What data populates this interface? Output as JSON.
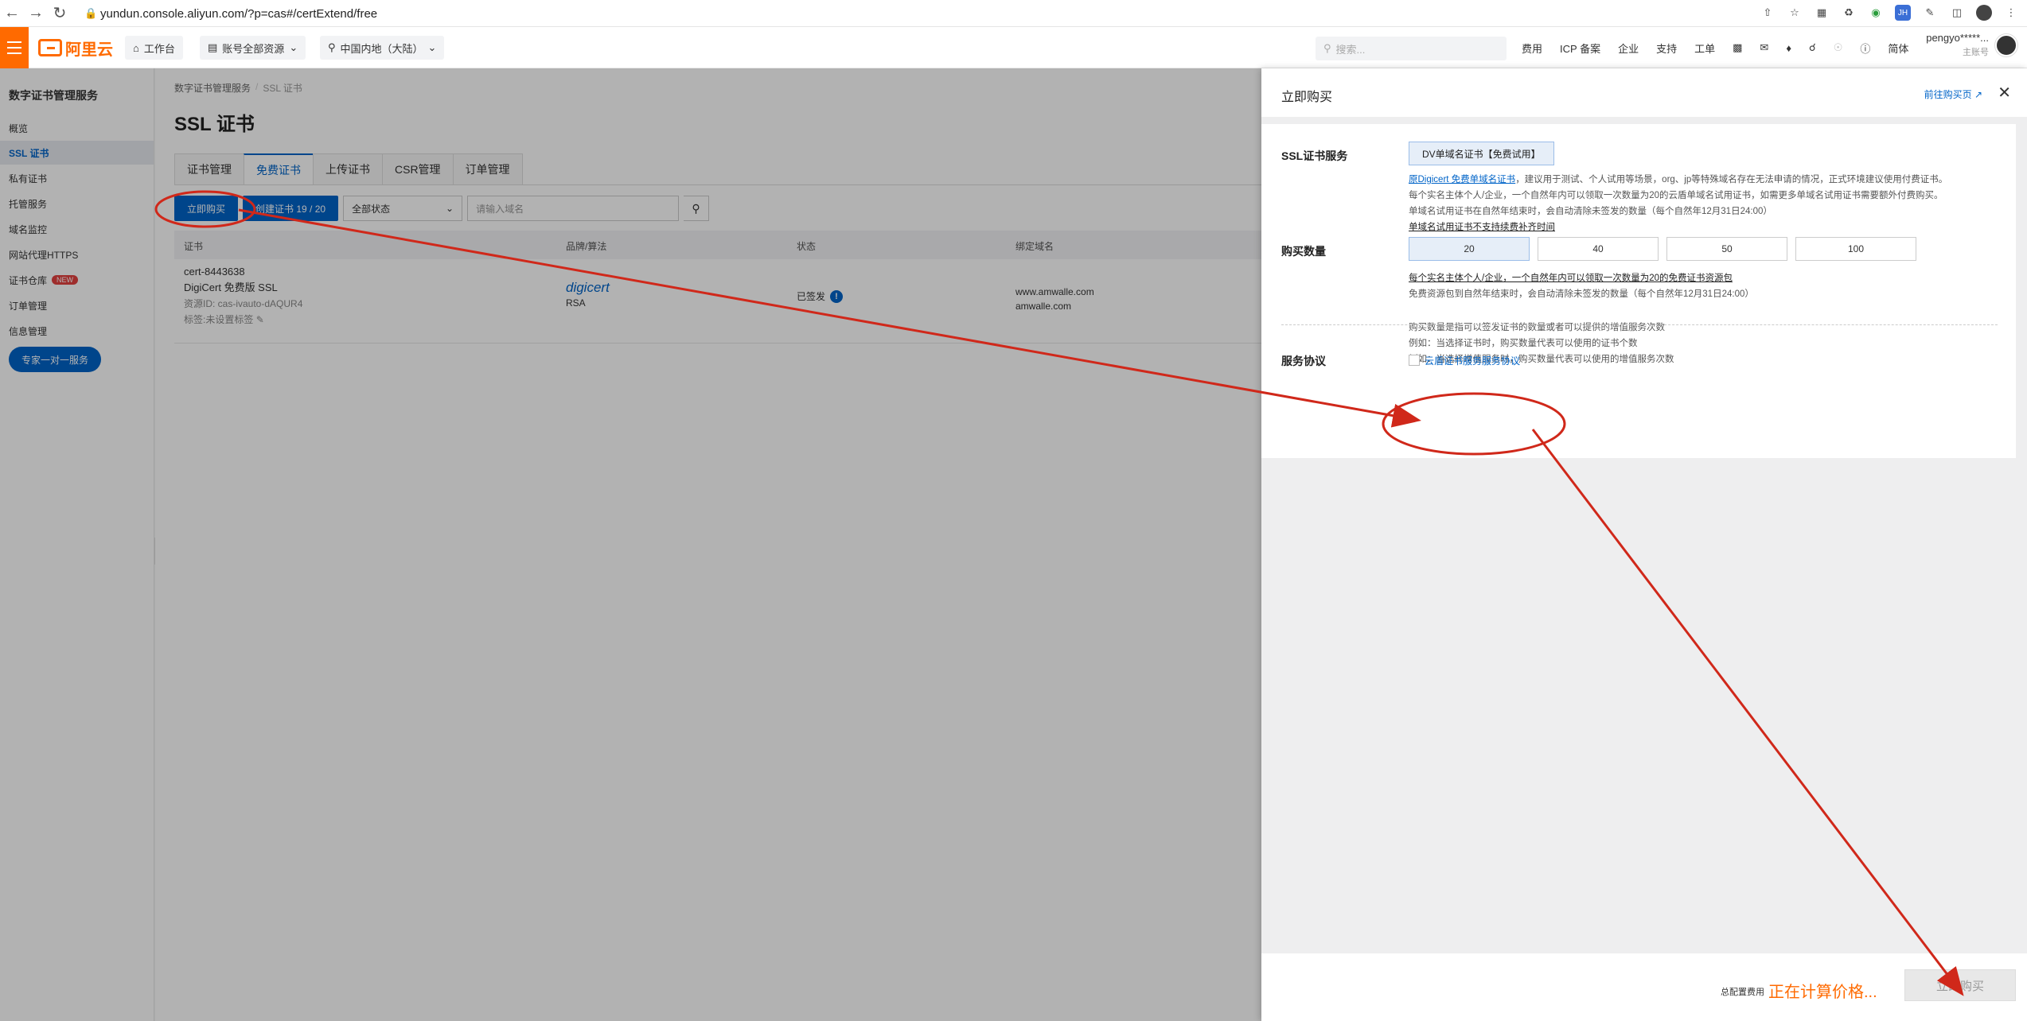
{
  "browser": {
    "url": "yundun.console.aliyun.com/?p=cas#/certExtend/free"
  },
  "topbar": {
    "logo_text": "阿里云",
    "workbench": "工作台",
    "account_resources": "账号全部资源",
    "region": "中国内地（大陆）",
    "search_placeholder": "搜索...",
    "nav": [
      "费用",
      "ICP 备案",
      "企业",
      "支持",
      "工单"
    ],
    "lang": "简体",
    "username": "pengyo*****...",
    "user_role": "主账号"
  },
  "sidebar": {
    "title": "数字证书管理服务",
    "items": [
      {
        "label": "概览"
      },
      {
        "label": "SSL 证书"
      },
      {
        "label": "私有证书"
      },
      {
        "label": "托管服务"
      },
      {
        "label": "域名监控"
      },
      {
        "label": "网站代理HTTPS"
      },
      {
        "label": "证书仓库",
        "badge": "NEW"
      },
      {
        "label": "订单管理"
      },
      {
        "label": "信息管理"
      }
    ],
    "expert_button": "专家一对一服务"
  },
  "main": {
    "breadcrumb": [
      "数字证书管理服务",
      "SSL 证书"
    ],
    "title": "SSL 证书",
    "tabs": [
      "证书管理",
      "免费证书",
      "上传证书",
      "CSR管理",
      "订单管理"
    ],
    "buy_button": "立即购买",
    "create_button": "创建证书 19 / 20",
    "status_select": "全部状态",
    "domain_placeholder": "请输入域名",
    "table": {
      "headers": [
        "证书",
        "品牌/算法",
        "状态",
        "绑定域名"
      ],
      "row": {
        "cert_id": "cert-8443638",
        "cert_name": "DigiCert 免费版 SSL",
        "resource_id": "资源ID: cas-ivauto-dAQUR4",
        "tag": "标签:未设置标签",
        "brand": "digicert",
        "algo": "RSA",
        "status": "已签发",
        "domain1": "www.amwalle.com",
        "domain2": "amwalle.com"
      }
    }
  },
  "drawer": {
    "title": "立即购买",
    "goto_buy_page": "前往购买页",
    "ssl_label": "SSL证书服务",
    "ssl_option": "DV单域名证书【免费试用】",
    "ssl_desc_link": "原Digicert 免费单域名证书",
    "ssl_desc_1": "，建议用于测试、个人试用等场景，org、jp等特殊域名存在无法申请的情况，正式环境建议使用付费证书。",
    "ssl_desc_2": "每个实名主体个人/企业，一个自然年内可以领取一次数量为20的云盾单域名试用证书，如需更多单域名试用证书需要额外付费购买。",
    "ssl_desc_3": "单域名试用证书在自然年结束时，会自动清除未签发的数量（每个自然年12月31日24:00）",
    "ssl_desc_4": "单域名试用证书不支持续费补齐时间",
    "qty_label": "购买数量",
    "qty_options": [
      "20",
      "40",
      "50",
      "100"
    ],
    "qty_desc_1": "每个实名主体个人/企业，一个自然年内可以领取一次数量为20的免费证书资源包",
    "qty_desc_2": "免费资源包到自然年结束时，会自动清除未签发的数量（每个自然年12月31日24:00）",
    "qty_desc_3": "购买数量是指可以签发证书的数量或者可以提供的增值服务次数",
    "qty_desc_4": "例如：当选择证书时，购买数量代表可以使用的证书个数",
    "qty_desc_5": "例如：当选择增值服务时，购买数量代表可以使用的增值服务次数",
    "agreement_label": "服务协议",
    "agreement_link": "云盾证书服务服务协议",
    "fee_label": "总配置费用",
    "fee_value": "正在计算价格...",
    "buy_button": "立即购买"
  },
  "colors": {
    "brand": "#ff6a00",
    "primary": "#0064c8",
    "annotation": "#d0281a"
  }
}
